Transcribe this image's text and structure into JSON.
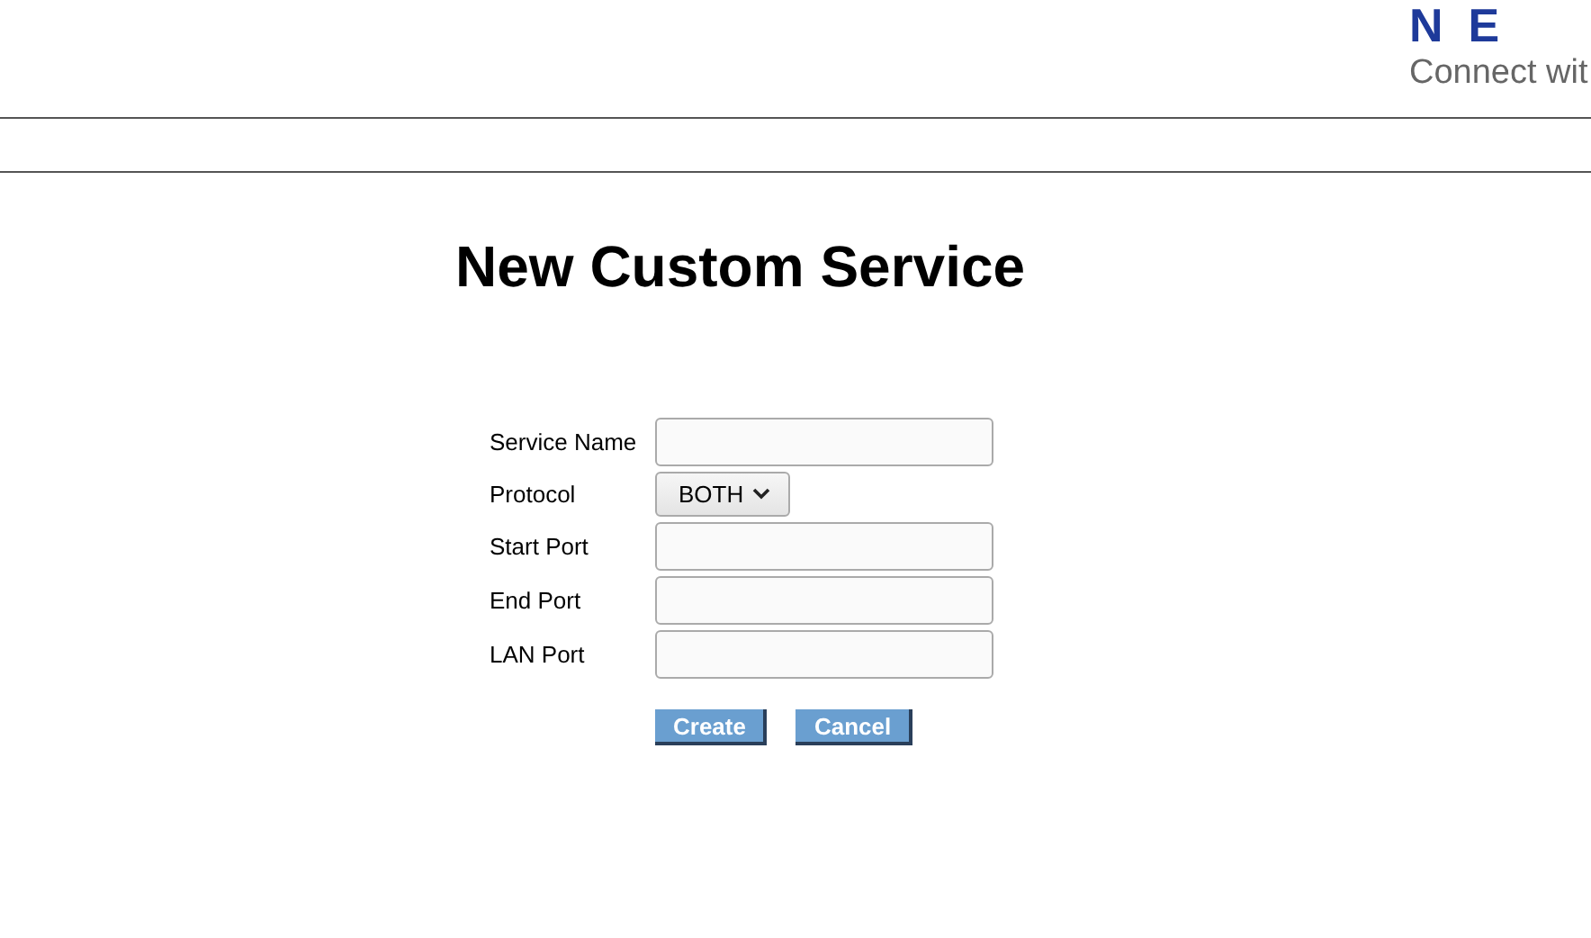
{
  "logo": {
    "wordmark": "NE",
    "tagline": "Connect wit"
  },
  "title": "New Custom Service",
  "fields": [
    {
      "kind": "text",
      "label": "Service Name"
    },
    {
      "kind": "select",
      "label": "Protocol",
      "value": "BOTH"
    },
    {
      "kind": "text",
      "label": "Start Port"
    },
    {
      "kind": "text",
      "label": "End Port"
    },
    {
      "kind": "text",
      "label": "LAN Port"
    }
  ],
  "buttons": [
    "Create",
    "Cancel"
  ]
}
